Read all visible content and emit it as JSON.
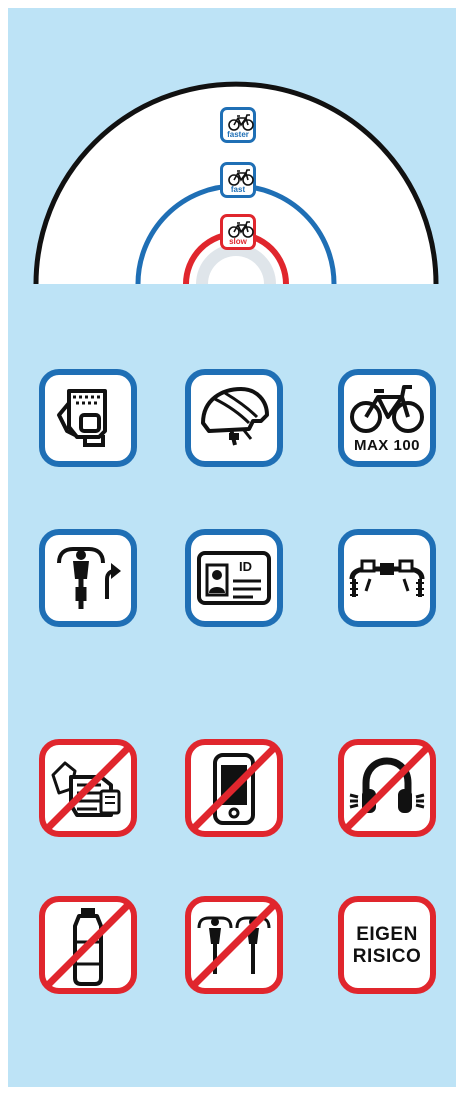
{
  "speed_badges": [
    {
      "label": "faster",
      "color": "#1f6fb5",
      "icon": "bicycle-icon"
    },
    {
      "label": "fast",
      "color": "#1f6fb5",
      "icon": "bicycle-icon"
    },
    {
      "label": "slow",
      "color": "#e0262d",
      "icon": "bicycle-icon"
    }
  ],
  "mandatory_icons": [
    {
      "icon": "gloves-icon"
    },
    {
      "icon": "helmet-icon"
    },
    {
      "icon": "bicycle-icon",
      "text": "MAX 100"
    },
    {
      "icon": "cyclist-look-back-icon"
    },
    {
      "icon": "id-card-icon"
    },
    {
      "icon": "handlebar-brakes-icon"
    }
  ],
  "prohibited_icons": [
    {
      "icon": "handshake-icon"
    },
    {
      "icon": "smartphone-icon"
    },
    {
      "icon": "headphones-icon"
    },
    {
      "icon": "water-bottle-icon"
    },
    {
      "icon": "cyclists-side-by-side-icon"
    },
    {
      "text_line1": "EIGEN",
      "text_line2": "RISICO"
    }
  ],
  "colors": {
    "background": "#bde3f6",
    "mandatory": "#1f6fb5",
    "prohibited": "#e0262d"
  }
}
